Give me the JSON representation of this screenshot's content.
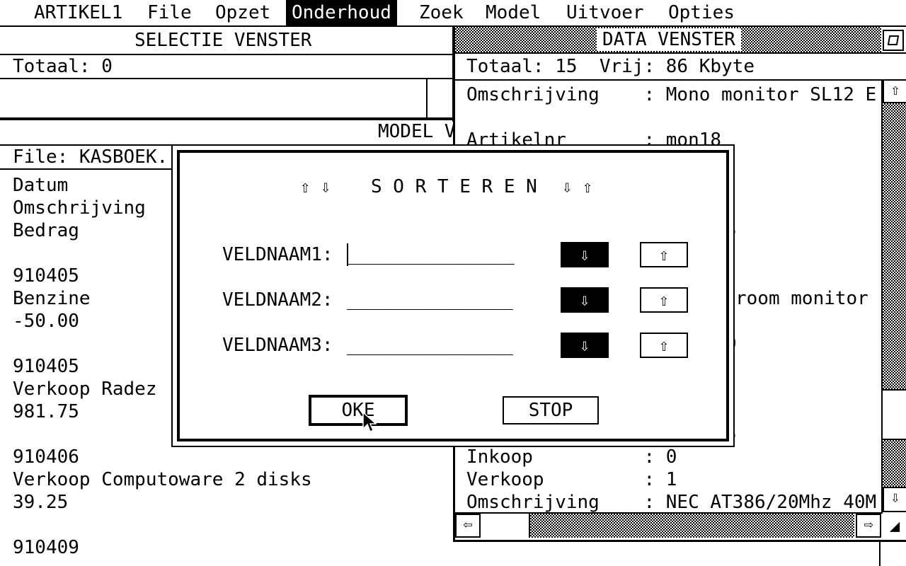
{
  "menubar": {
    "items": [
      {
        "label": "ARTIKEL1",
        "active": false
      },
      {
        "label": "File",
        "active": false
      },
      {
        "label": "Opzet",
        "active": false
      },
      {
        "label": "Onderhoud",
        "active": true
      },
      {
        "label": "Zoek",
        "active": false
      },
      {
        "label": "Model",
        "active": false
      },
      {
        "label": "Uitvoer",
        "active": false
      },
      {
        "label": "Opties",
        "active": false
      }
    ]
  },
  "selectie_window": {
    "title": "SELECTIE VENSTER",
    "totaal": "Totaal: 0"
  },
  "model_window": {
    "title": "MODEL V",
    "file": "File: KASBOEK.",
    "lines": [
      "Datum",
      "Omschrijving",
      "Bedrag",
      "",
      "910405",
      "Benzine",
      "-50.00",
      "",
      "910405",
      "Verkoop Radez",
      "981.75",
      "",
      "910406",
      "Verkoop Computoware 2 disks",
      "39.25",
      "",
      "910409"
    ]
  },
  "data_window": {
    "title": "DATA VENSTER",
    "status": "Totaal: 15  Vrij: 86 Kbyte",
    "close_icon": "fuller-icon",
    "top_lines": [
      "Omschrijving    : Mono monitor SL12 E",
      "",
      "Artikelnr       : mon18"
    ],
    "partial_right": [
      "5",
      "",
      "room monitor",
      "",
      "0",
      "",
      "",
      "",
      "5"
    ],
    "bottom_lines": [
      "Inkoop          : 0",
      "Verkoop         : 1",
      "Omschrijving    : NEC AT386/20Mhz 40M"
    ],
    "scroll_up": "⇧",
    "scroll_down": "⇩",
    "scroll_left": "⇦",
    "scroll_right": "⇨",
    "resize": "◢"
  },
  "dialog": {
    "arrows_left": "⇧ ⇩",
    "title": "S O R T E R E N",
    "arrows_right": "⇩ ⇧",
    "fields": [
      {
        "label": "VELDNAAM1:",
        "value": "_______________",
        "desc_label": "⇩",
        "asc_label": "⇧"
      },
      {
        "label": "VELDNAAM2:",
        "value": "_______________",
        "desc_label": "⇩",
        "asc_label": "⇧"
      },
      {
        "label": "VELDNAAM3:",
        "value": "_______________",
        "desc_label": "⇩",
        "asc_label": "⇧"
      }
    ],
    "ok_label": "OKE",
    "stop_label": "STOP"
  }
}
